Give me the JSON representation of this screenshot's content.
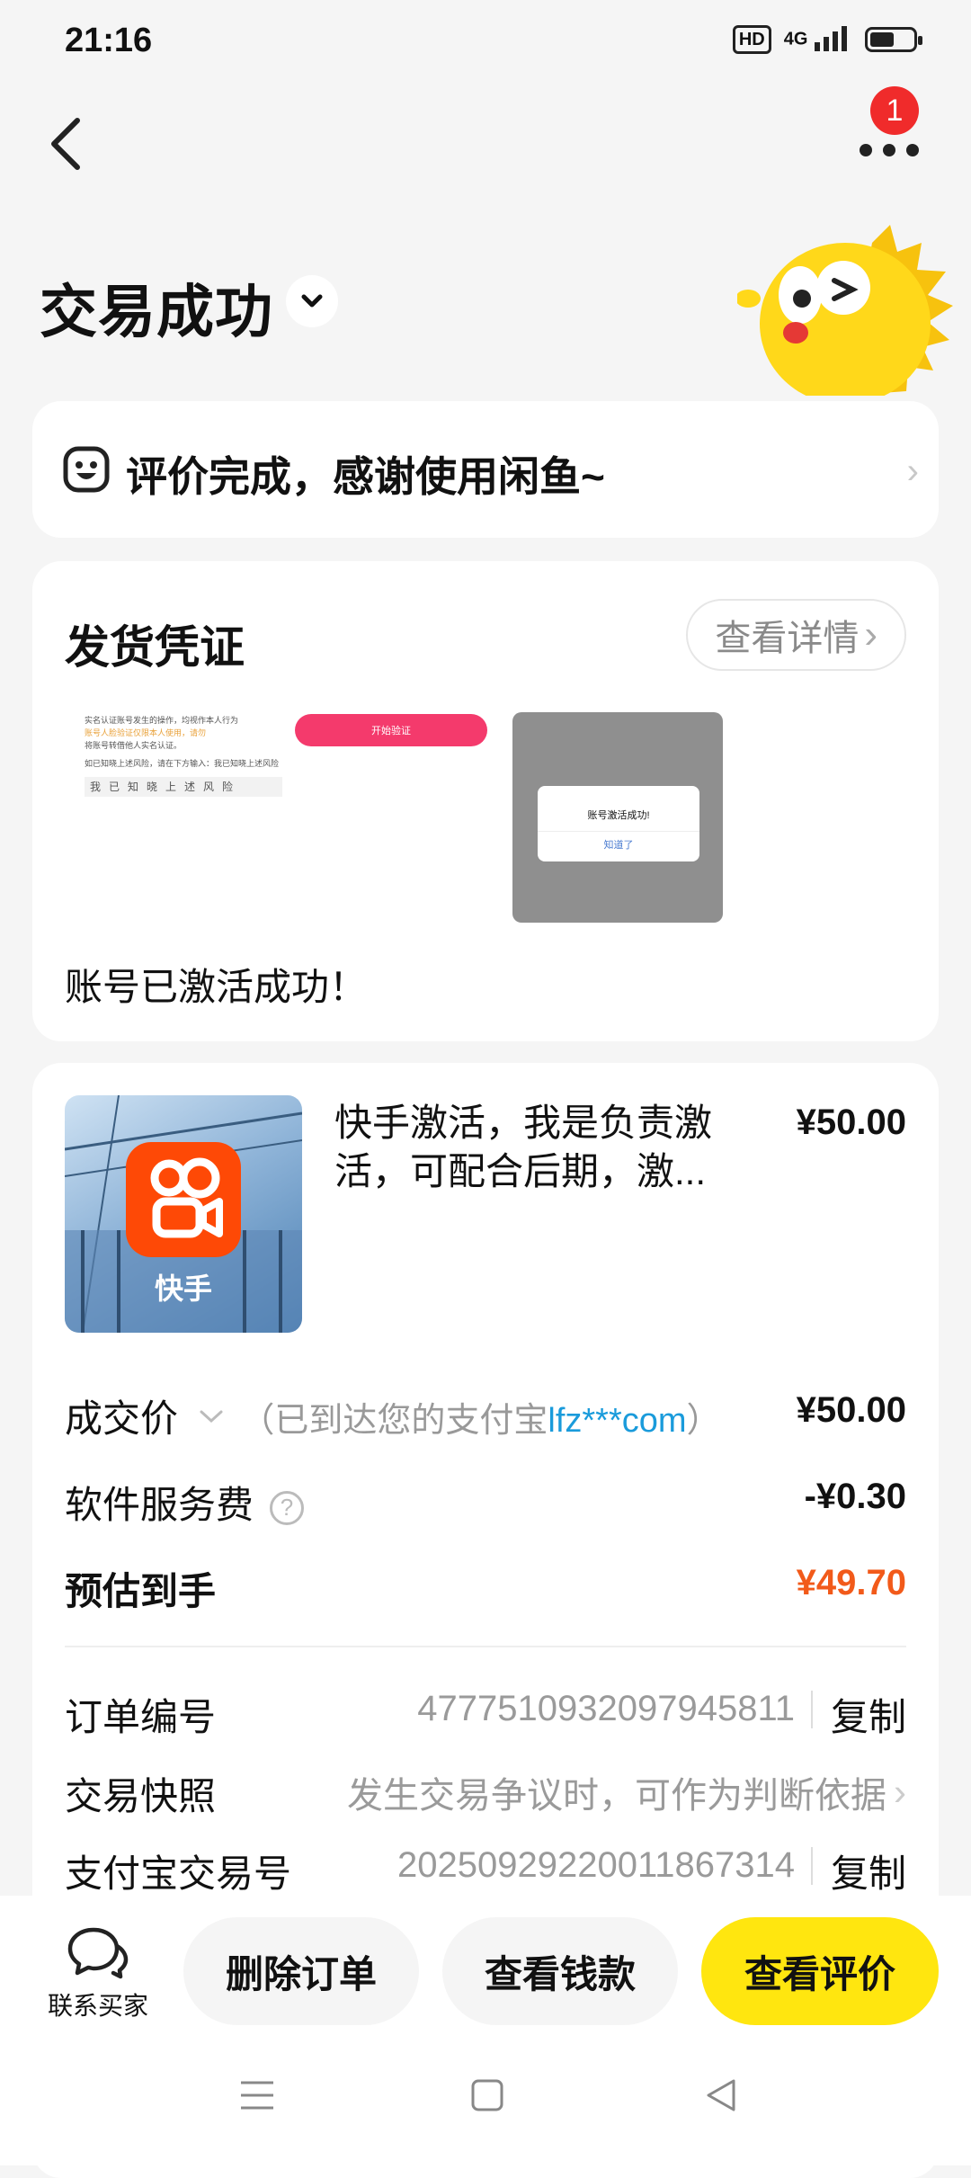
{
  "status_bar": {
    "time": "21:16",
    "hd": "HD",
    "network": "4G"
  },
  "header": {
    "more_badge": "1"
  },
  "title": "交易成功",
  "evaluation": {
    "text": "评价完成，感谢使用闲鱼~"
  },
  "proof": {
    "title": "发货凭证",
    "detail_button": "查看详情",
    "thumb1_lines": [
      "实名认证账号发生的操作，均视作本人行为",
      "账号人脸验证仅限本人使用，请勿",
      "将账号转借他人实名认证。",
      "如已知晓上述风险，请在下方输入：我已知晓上述风险"
    ],
    "thumb1_chars": "我已知晓上述风险",
    "thumb2_button": "开始验证",
    "thumb3_dialog_title": "账号激活成功!",
    "thumb3_dialog_button": "知道了",
    "text": "账号已激活成功！"
  },
  "product": {
    "logo_text": "快手",
    "title": "快手激活，我是负责激活，可配合后期，激...",
    "price": "¥50.00"
  },
  "price_rows": {
    "deal_label": "成交价",
    "deal_note_prefix": "（已到达您的支付宝",
    "deal_note_account": "lfz***com",
    "deal_note_suffix": "）",
    "deal_value": "¥50.00",
    "fee_label": "软件服务费",
    "fee_value": "-¥0.30",
    "estimate_label": "预估到手",
    "estimate_value": "¥49.70"
  },
  "info_rows": {
    "order_no_label": "订单编号",
    "order_no_value": "4777510932097945811",
    "snapshot_label": "交易快照",
    "snapshot_value": "发生交易争议时，可作为判断依据",
    "alipay_label": "支付宝交易号",
    "alipay_value": "2025092922001186731​4",
    "copy": "复制"
  },
  "bottom_bar": {
    "contact": "联系买家",
    "delete": "删除订单",
    "view_money": "查看钱款",
    "view_review": "查看评价"
  },
  "colors": {
    "accent_yellow": "#ffe60f",
    "price_orange": "#f25a1a",
    "link_blue": "#1a9bdb",
    "badge_red": "#f02b2b",
    "kuaishou_orange": "#fe4906"
  }
}
